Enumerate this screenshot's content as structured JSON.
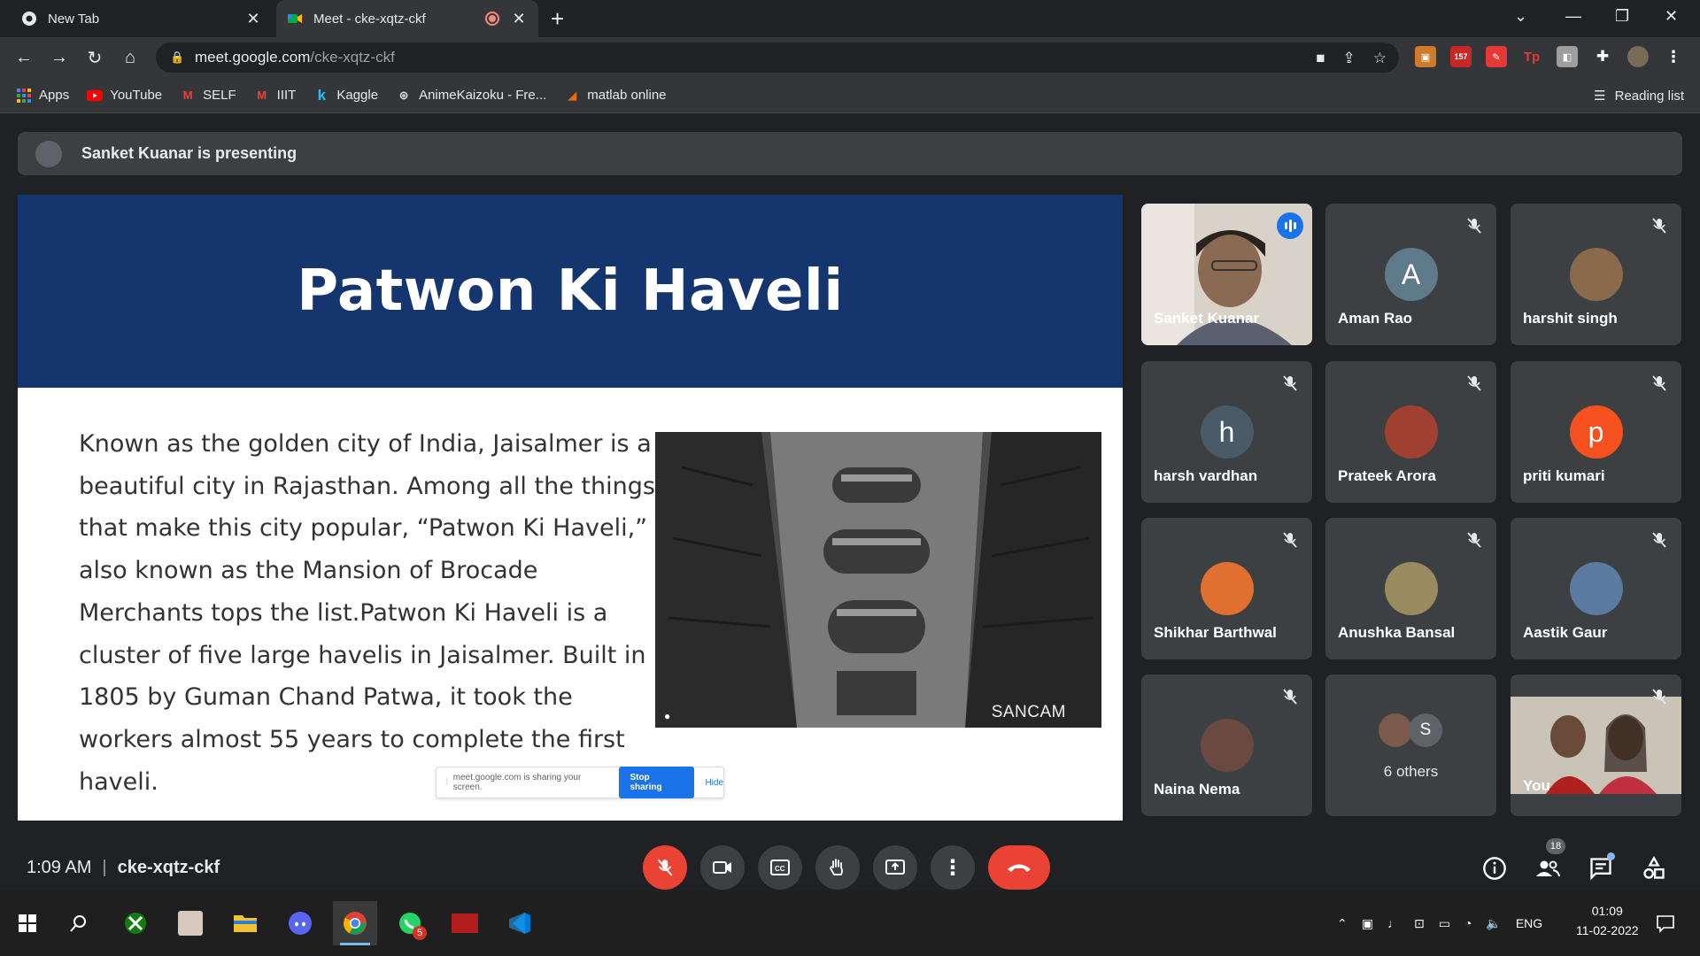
{
  "browser": {
    "tabs": [
      {
        "title": "New Tab",
        "active": false
      },
      {
        "title": "Meet - cke-xqtz-ckf",
        "active": true
      }
    ],
    "url_host": "meet.google.com",
    "url_path": "/cke-xqtz-ckf",
    "extension_badge": "157",
    "bookmarks": [
      {
        "label": "Apps",
        "icon": "apps-grid-icon"
      },
      {
        "label": "YouTube",
        "icon": "youtube-icon"
      },
      {
        "label": "SELF",
        "icon": "gmail-icon"
      },
      {
        "label": "IIIT",
        "icon": "gmail-icon"
      },
      {
        "label": "Kaggle",
        "icon": "kaggle-icon"
      },
      {
        "label": "AnimeKaizoku - Fre...",
        "icon": "anime-icon"
      },
      {
        "label": "matlab online",
        "icon": "matlab-icon"
      }
    ],
    "reading_list": "Reading list"
  },
  "meet": {
    "presenting_banner": "Sanket Kuanar is presenting",
    "slide": {
      "title": "Patwon Ki Haveli",
      "body": "Known as the golden city of India, Jaisalmer is a beautiful city in Rajasthan. Among all the things that make this city popular, “Patwon Ki Haveli,” also known as the Mansion of Brocade Merchants tops the list.Patwon Ki Haveli is a cluster of five large havelis in Jaisalmer. Built in 1805 by Guman Chand Patwa, it took the workers almost 55 years to complete the first haveli.",
      "photo_credit": "SANCAM",
      "share_notice": "meet.google.com is sharing your screen.",
      "stop_sharing": "Stop sharing",
      "hide": "Hide"
    },
    "participants": [
      {
        "name": "Sanket Kuanar",
        "type": "video",
        "speaking": true
      },
      {
        "name": "Aman Rao",
        "type": "letter",
        "letter": "A",
        "color": "#5f7a8a"
      },
      {
        "name": "harshit singh",
        "type": "photo",
        "color": "#8a6a4a"
      },
      {
        "name": "harsh vardhan",
        "type": "letter",
        "letter": "h",
        "color": "#4a5a66"
      },
      {
        "name": "Prateek Arora",
        "type": "photo",
        "color": "#a04030"
      },
      {
        "name": "priti kumari",
        "type": "letter",
        "letter": "p",
        "color": "#f4511e"
      },
      {
        "name": "Shikhar Barthwal",
        "type": "photo",
        "color": "#e07030"
      },
      {
        "name": "Anushka Bansal",
        "type": "photo",
        "color": "#9a8a60"
      },
      {
        "name": "Aastik Gaur",
        "type": "photo",
        "color": "#5a7aa0"
      },
      {
        "name": "Naina Nema",
        "type": "photo",
        "color": "#6a4a40"
      }
    ],
    "others_label": "6 others",
    "others_letter": "S",
    "self_label": "You",
    "time": "1:09 AM",
    "meeting_code": "cke-xqtz-ckf",
    "people_count": "18"
  },
  "taskbar": {
    "language": "ENG",
    "clock_time": "01:09",
    "clock_date": "11-02-2022",
    "whatsapp_badge": "5"
  },
  "colors": {
    "slide_header": "#15356e",
    "end_call": "#ea4335",
    "speaking_outline": "#8ab4f8"
  }
}
